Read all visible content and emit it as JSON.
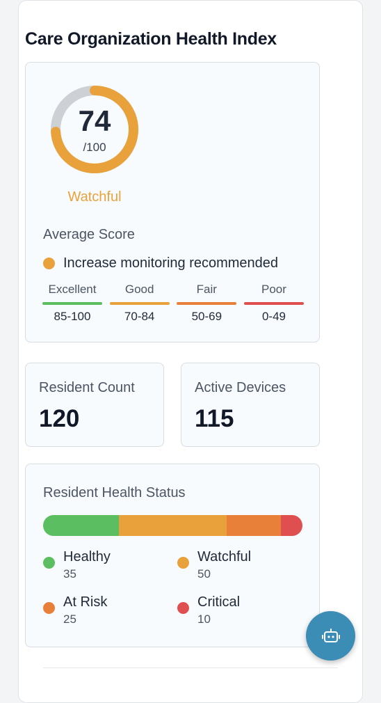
{
  "title": "Care Organization Health Index",
  "score": {
    "value": "74",
    "max": "/100",
    "fraction": 0.74,
    "status": "Watchful",
    "status_color": "#e9a23b",
    "average_label": "Average Score",
    "recommendation": "Increase monitoring recommended",
    "scale": [
      {
        "name": "Excellent",
        "range": "85-100",
        "color": "#5bbf62"
      },
      {
        "name": "Good",
        "range": "70-84",
        "color": "#e9a23b"
      },
      {
        "name": "Fair",
        "range": "50-69",
        "color": "#e8803a"
      },
      {
        "name": "Poor",
        "range": "0-49",
        "color": "#df4f4f"
      }
    ]
  },
  "metrics": {
    "residents": {
      "label": "Resident Count",
      "value": "120"
    },
    "devices": {
      "label": "Active Devices",
      "value": "115"
    }
  },
  "health_status": {
    "title": "Resident Health Status",
    "items": [
      {
        "name": "Healthy",
        "count": "35",
        "value": 35,
        "color": "#5bbf62"
      },
      {
        "name": "Watchful",
        "count": "50",
        "value": 50,
        "color": "#e9a23b"
      },
      {
        "name": "At Risk",
        "count": "25",
        "value": 25,
        "color": "#e8803a"
      },
      {
        "name": "Critical",
        "count": "10",
        "value": 10,
        "color": "#df4f4f"
      }
    ]
  },
  "assistant_button": {
    "icon": "robot-icon"
  }
}
